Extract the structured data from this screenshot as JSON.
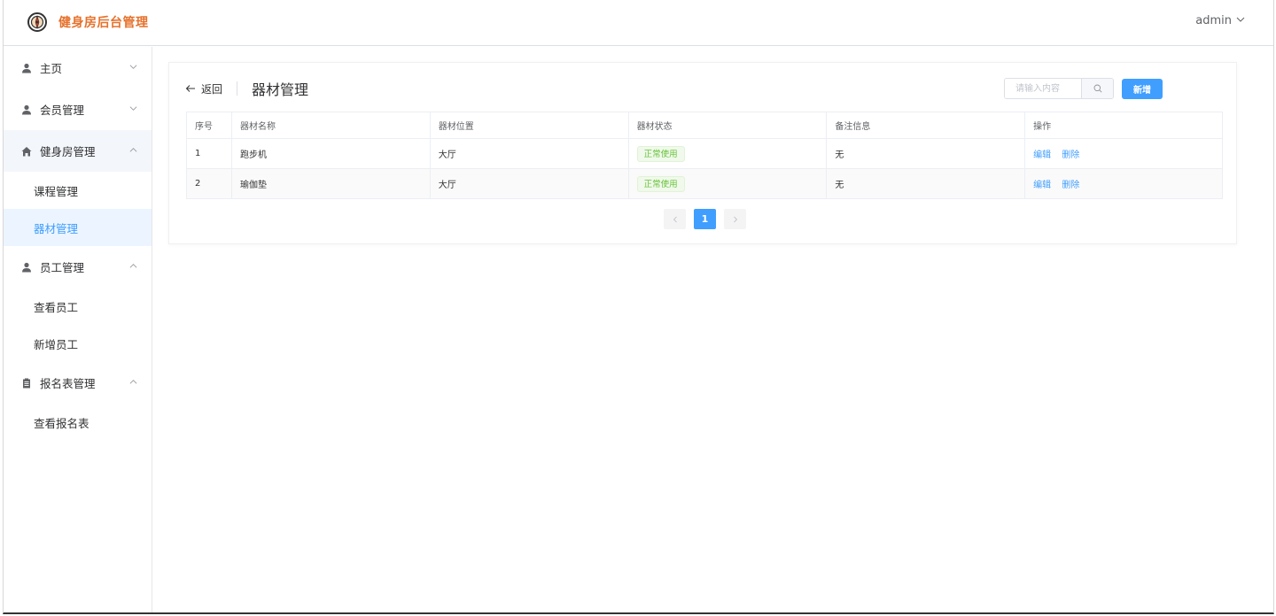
{
  "header": {
    "brand": "健身房后台管理",
    "user": "admin",
    "logo_icon": "compass-logo-icon"
  },
  "sidebar": {
    "groups": [
      {
        "label": "主页",
        "icon": "user-icon",
        "expanded": false
      },
      {
        "label": "会员管理",
        "icon": "user-icon",
        "expanded": false
      },
      {
        "label": "健身房管理",
        "icon": "home-icon",
        "expanded": true,
        "items": [
          {
            "label": "课程管理"
          },
          {
            "label": "器材管理",
            "active": true
          }
        ]
      },
      {
        "label": "员工管理",
        "icon": "user-icon",
        "expanded": true,
        "items": [
          {
            "label": "查看员工"
          },
          {
            "label": "新增员工"
          }
        ]
      },
      {
        "label": "报名表管理",
        "icon": "clipboard-icon",
        "expanded": true,
        "items": [
          {
            "label": "查看报名表"
          }
        ]
      }
    ]
  },
  "page": {
    "back_label": "返回",
    "title": "器材管理",
    "search_placeholder": "请输入内容",
    "add_label": "新增"
  },
  "table": {
    "columns": [
      "序号",
      "器材名称",
      "器材位置",
      "器材状态",
      "备注信息",
      "操作"
    ],
    "rows": [
      {
        "index": "1",
        "name": "跑步机",
        "location": "大厅",
        "status": "正常使用",
        "remark": "无"
      },
      {
        "index": "2",
        "name": "瑜伽垫",
        "location": "大厅",
        "status": "正常使用",
        "remark": "无"
      }
    ],
    "edit_label": "编辑",
    "delete_label": "删除"
  },
  "pagination": {
    "current": "1"
  },
  "colors": {
    "primary": "#409eff",
    "brand": "#e6712b",
    "success": "#67c23a"
  }
}
